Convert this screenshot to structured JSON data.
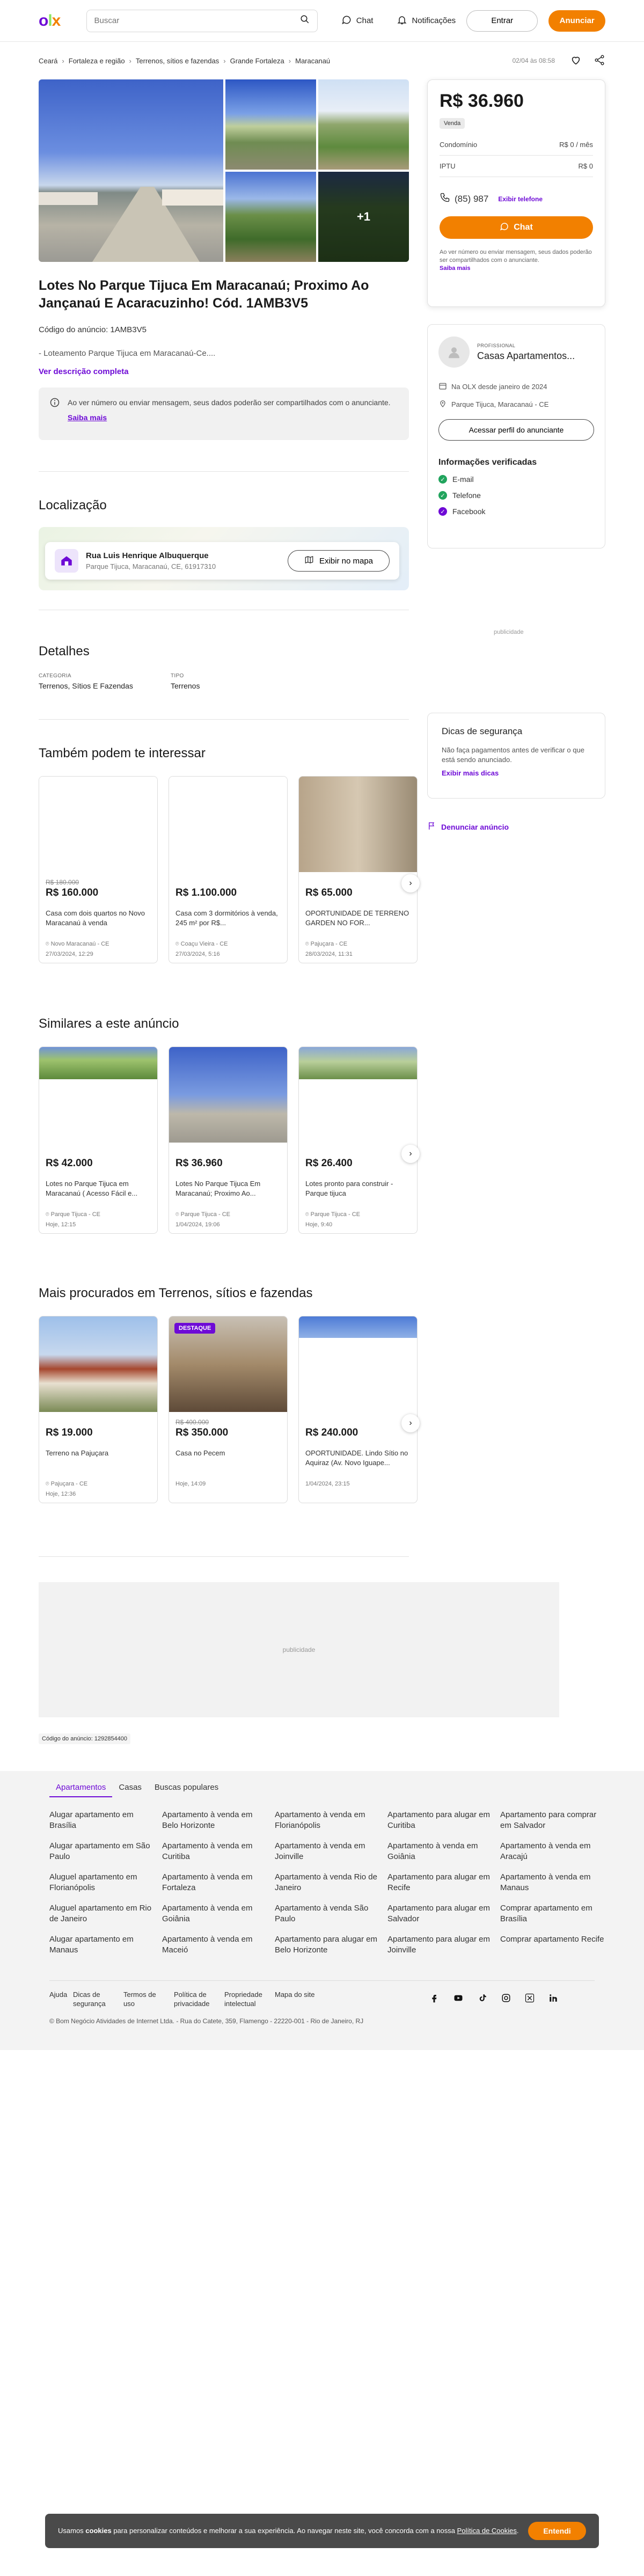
{
  "header": {
    "logo": {
      "o": "o",
      "l": "l",
      "x": "x"
    },
    "search_placeholder": "Buscar",
    "chat_label": "Chat",
    "notifications_label": "Notificações",
    "login_label": "Entrar",
    "post_ad_label": "Anunciar"
  },
  "breadcrumb": {
    "items": [
      "Ceará",
      "Fortaleza e região",
      "Terrenos, sítios e fazendas",
      "Grande Fortaleza",
      "Maracanaú"
    ],
    "published": "02/04 às 08:58"
  },
  "gallery": {
    "more": "+1"
  },
  "listing": {
    "title": "Lotes No Parque Tijuca Em Maracanaú; Proximo Ao Jançanaú E Acaracuzinho! Cód. 1AMB3V5",
    "code_line": "Código do anúncio: 1AMB3V5",
    "description_preview": "- Loteamento Parque Tijuca em Maracanaú-Ce....",
    "description_link": "Ver descrição completa",
    "alert_text": "Ao ver número ou enviar mensagem, seus dados poderão ser compartilhados com o anunciante.",
    "alert_link": "Saiba mais"
  },
  "location": {
    "heading": "Localização",
    "street": "Rua Luis Henrique Albuquerque",
    "area": "Parque Tijuca, Maracanaú, CE, 61917310",
    "map_button": "Exibir no mapa"
  },
  "details": {
    "heading": "Detalhes",
    "fields": [
      {
        "label": "Categoria",
        "value": "Terrenos, Sítios E Fazendas"
      },
      {
        "label": "Tipo",
        "value": "Terrenos"
      }
    ]
  },
  "price_box": {
    "price": "R$ 36.960",
    "tag": "Venda",
    "rows": [
      {
        "label": "Condomínio",
        "value": "R$ 0 / mês"
      },
      {
        "label": "IPTU",
        "value": "R$ 0"
      }
    ],
    "phone": "(85) 987",
    "show_phone": "Exibir telefone",
    "chat_button": "Chat",
    "note": "Ao ver número ou enviar mensagem, seus dados poderão ser compartilhados com o anunciante.",
    "note_link": "Saiba mais"
  },
  "seller": {
    "type": "Profissional",
    "name": "Casas Apartamentos...",
    "since": "Na OLX desde janeiro de 2024",
    "location": "Parque Tijuca, Maracanaú - CE",
    "profile_button": "Acessar perfil do anunciante",
    "verified_title": "Informações verificadas",
    "verified": [
      "E-mail",
      "Telefone",
      "Facebook"
    ]
  },
  "sidebar_ad": "publicidade",
  "safety": {
    "title": "Dicas de segurança",
    "text": "Não faça pagamentos antes de verificar o que está sendo anunciado.",
    "link": "Exibir mais dicas"
  },
  "report_link": "Denunciar anúncio",
  "section_interest": {
    "heading": "Também podem te interessar",
    "cards": [
      {
        "old_price": "R$ 180.000",
        "price": "R$ 160.000",
        "name": "Casa com dois quartos no Novo Maracanaú à venda",
        "location": "Novo Maracanaú - CE",
        "date": "27/03/2024, 12:29",
        "img": "blank"
      },
      {
        "old_price": "",
        "price": "R$ 1.100.000",
        "name": "Casa com 3 dormitórios à venda, 245 m² por R$...",
        "location": "Coaçu Vieira - CE",
        "date": "27/03/2024, 5:16",
        "img": "blank"
      },
      {
        "old_price": "",
        "price": "R$ 65.000",
        "name": "OPORTUNIDADE DE TERRENO GARDEN NO FOR...",
        "location": "Pajuçara - CE",
        "date": "28/03/2024, 11:31",
        "img": "room"
      }
    ]
  },
  "section_similar": {
    "heading": "Similares a este anúncio",
    "cards": [
      {
        "old_price": "",
        "price": "R$ 42.000",
        "name": "Lotes no Parque Tijuca em Maracanaú ( Acesso Fácil e...",
        "location": "Parque Tijuca - CE",
        "date": "Hoje, 12:15",
        "img": "field"
      },
      {
        "old_price": "",
        "price": "R$ 36.960",
        "name": "Lotes No Parque Tijuca Em Maracanaú; Proximo Ao...",
        "location": "Parque Tijuca - CE",
        "date": "1/04/2024, 19:06",
        "img": "street"
      },
      {
        "old_price": "",
        "price": "R$ 26.400",
        "name": "Lotes pronto para construir - Parque tijuca",
        "location": "Parque Tijuca - CE",
        "date": "Hoje, 9:40",
        "img": "field"
      }
    ]
  },
  "section_popular": {
    "heading": "Mais procurados em Terrenos, sítios e fazendas",
    "cards": [
      {
        "old_price": "",
        "price": "R$ 19.000",
        "name": "Terreno na Pajuçara",
        "location": "Pajuçara - CE",
        "date": "Hoje, 12:36",
        "img": "house",
        "badge": ""
      },
      {
        "old_price": "R$ 400.000",
        "price": "R$ 350.000",
        "name": "Casa no Pecem",
        "location": "",
        "date": "Hoje, 14:09",
        "img": "bedroom",
        "badge": "DESTAQUE"
      },
      {
        "old_price": "",
        "price": "R$ 240.000",
        "name": "OPORTUNIDADE. Lindo Sítio no Aquiraz (Av. Novo Iguape...",
        "location": "",
        "date": "1/04/2024, 23:15",
        "img": "sky",
        "badge": ""
      }
    ]
  },
  "main_ad": "publicidade",
  "ad_code": "Código do anúncio: 1292854400",
  "footer": {
    "tabs": [
      "Apartamentos",
      "Casas",
      "Buscas populares"
    ],
    "links": [
      "Alugar apartamento em Brasília",
      "Apartamento à venda em Belo Horizonte",
      "Apartamento à venda em Florianópolis",
      "Apartamento para alugar em Curitiba",
      "Apartamento para comprar em Salvador",
      "Alugar apartamento em São Paulo",
      "Apartamento à venda em Curitiba",
      "Apartamento à venda em Joinville",
      "Apartamento à venda em Goiânia",
      "Apartamento à venda em Aracajú",
      "Aluguel apartamento em Florianópolis",
      "Apartamento à venda em Fortaleza",
      "Apartamento à venda Rio de Janeiro",
      "Apartamento para alugar em Recife",
      "Apartamento à venda em Manaus",
      "Aluguel apartamento em Rio de Janeiro",
      "Apartamento à venda em Goiânia",
      "Apartamento à venda São Paulo",
      "Apartamento para alugar em Salvador",
      "Comprar apartamento em Brasília",
      "Alugar apartamento em Manaus",
      "Apartamento à venda em Maceió",
      "Apartamento para alugar em Belo Horizonte",
      "Apartamento para alugar em Joinville",
      "Comprar apartamento Recife"
    ],
    "bottom_links": [
      "Ajuda",
      "Dicas de segurança",
      "Termos de uso",
      "Política de privacidade",
      "Propriedade intelectual",
      "Mapa do site"
    ],
    "copyright": "© Bom Negócio Atividades de Internet Ltda. - Rua do Catete, 359, Flamengo - 22220-001 - Rio de Janeiro, RJ"
  },
  "cookie": {
    "pre": "Usamos ",
    "bold": "cookies",
    "text": " para personalizar conteúdos e melhorar a sua experiência. Ao navegar neste site, você concorda com a nossa ",
    "link": "Política de Cookies",
    "post": ".",
    "button": "Entendi"
  },
  "colors": {
    "brand_purple": "#6e0ad6",
    "brand_orange": "#f28000",
    "brand_green": "#8ce563"
  }
}
